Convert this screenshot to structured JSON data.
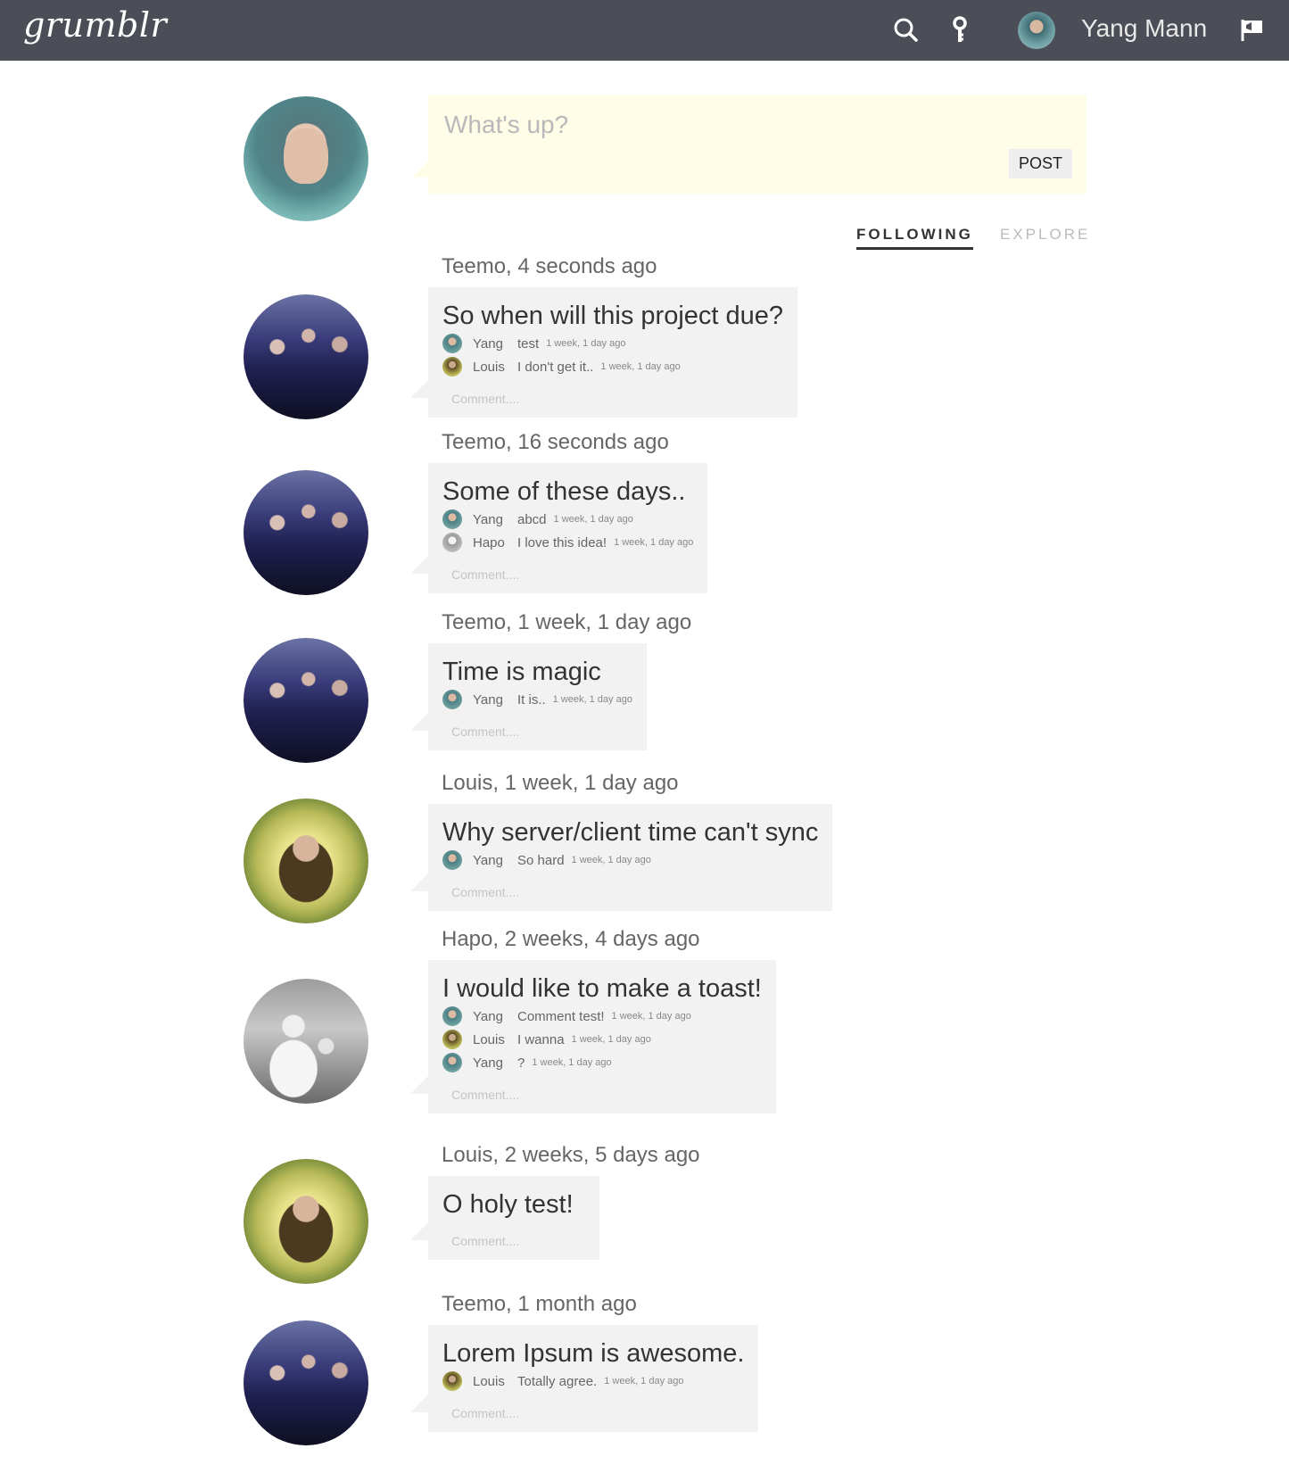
{
  "app": {
    "logo": "grumblr"
  },
  "header": {
    "search_icon": "search-icon",
    "key_icon": "key-icon",
    "user_name": "Yang Mann",
    "flag_icon": "flag-icon"
  },
  "composer": {
    "placeholder": "What's up?",
    "post_label": "POST"
  },
  "tabs": {
    "following": "FOLLOWING",
    "explore": "EXPLORE"
  },
  "comment_placeholder": "Comment....",
  "posts": [
    {
      "meta": "Teemo, 4 seconds ago",
      "title": "So when will this project due?",
      "comments": [
        {
          "author": "Yang",
          "text": "test",
          "time": "1 week, 1 day ago"
        },
        {
          "author": "Louis",
          "text": "I don't get it..",
          "time": "1 week, 1 day ago"
        }
      ]
    },
    {
      "meta": "Teemo, 16 seconds ago",
      "title": "Some of these days..",
      "comments": [
        {
          "author": "Yang",
          "text": "abcd",
          "time": "1 week, 1 day ago"
        },
        {
          "author": "Hapo",
          "text": "I love this idea!",
          "time": "1 week, 1 day ago"
        }
      ]
    },
    {
      "meta": "Teemo, 1 week, 1 day ago",
      "title": "Time is magic",
      "comments": [
        {
          "author": "Yang",
          "text": "It is..",
          "time": "1 week, 1 day ago"
        }
      ]
    },
    {
      "meta": "Louis, 1 week, 1 day ago",
      "title": "Why server/client time can't sync",
      "comments": [
        {
          "author": "Yang",
          "text": "So hard",
          "time": "1 week, 1 day ago"
        }
      ]
    },
    {
      "meta": "Hapo, 2 weeks, 4 days ago",
      "title": "I would like to make a toast!",
      "comments": [
        {
          "author": "Yang",
          "text": "Comment test!",
          "time": "1 week, 1 day ago"
        },
        {
          "author": "Louis",
          "text": "I wanna",
          "time": "1 week, 1 day ago"
        },
        {
          "author": "Yang",
          "text": "?",
          "time": "1 week, 1 day ago"
        }
      ]
    },
    {
      "meta": "Louis, 2 weeks, 5 days ago",
      "title": "O holy test!",
      "comments": []
    },
    {
      "meta": "Teemo, 1 month ago",
      "title": "Lorem Ipsum is awesome.",
      "comments": [
        {
          "author": "Louis",
          "text": "Totally agree.",
          "time": "1 week, 1 day ago"
        }
      ]
    }
  ]
}
